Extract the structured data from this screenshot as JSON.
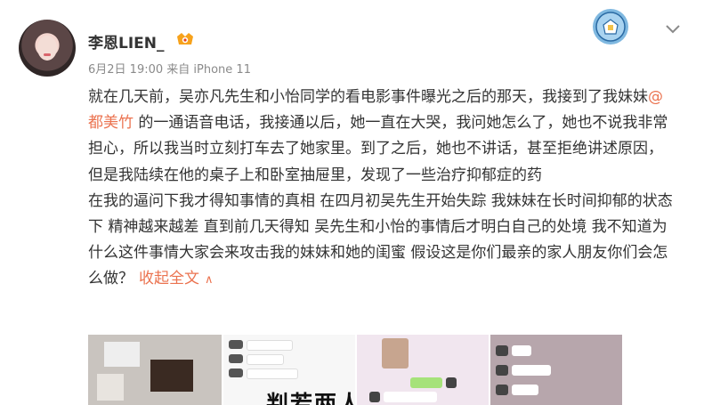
{
  "post": {
    "username": "李恩LIEN_",
    "meta": "6月2日 19:00 来自 iPhone 11",
    "body_part1": "就在几天前，吴亦凡先生和小怡同学的看电影事件曝光之后的那天，我接到了我妹妹",
    "mention": "@都美竹",
    "body_part2": " 的一通语音电话，我接通以后，她一直在大哭，我问她怎么了，她也不说我非常担心，所以我当时立刻打车去了她家里。到了之后，她也不讲话，甚至拒绝讲述原因，但是我陆续在他的桌子上和卧室抽屉里，发现了一些治疗抑郁症的药",
    "body_paragraph2": "在我的逼问下我才得知事情的真相  在四月初吴先生开始失踪  我妹妹在长时间抑郁的状态下  精神越来越差  直到前几天得知  吴先生和小怡的事情后才明白自己的处境  我不知道为什么这件事情大家会来攻击我的妹妹和她的闺蜜   假设这是你们最亲的家人朋友你们会怎么做？",
    "collapse_label": "收起全文",
    "collapse_icon": "chevron-up-icon",
    "accent_color": "#eb7350"
  },
  "images": {
    "thumb2_caption": "判若两人"
  }
}
